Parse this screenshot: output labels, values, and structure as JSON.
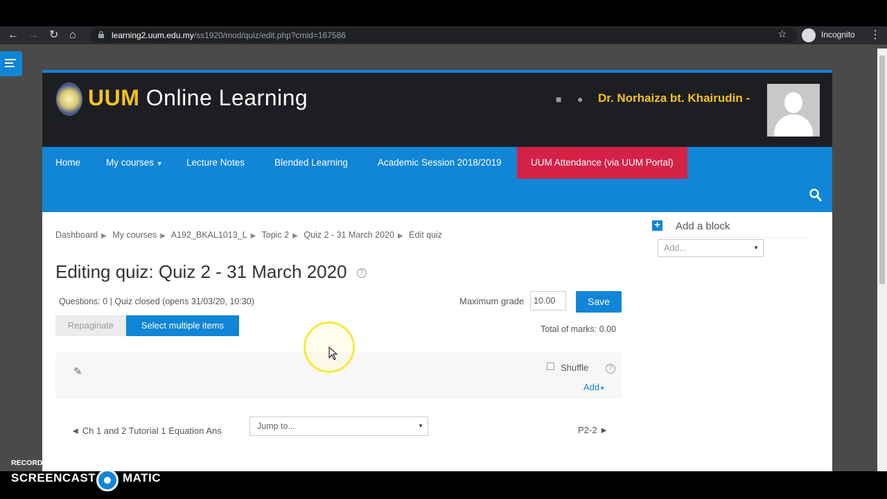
{
  "browser": {
    "url_host": "learning2.uum.edu.my",
    "url_path": "/ss1920/mod/quiz/edit.php?cmid=167586",
    "profile_label": "Incognito"
  },
  "header": {
    "brand_uum": "UUM",
    "brand_rest": " Online Learning",
    "username": "Dr. Norhaiza bt. Khairudin -"
  },
  "nav": {
    "items": [
      "Home",
      "My courses",
      "Lecture Notes",
      "Blended Learning",
      "Academic Session 2018/2019",
      "UUM Attendance (via UUM Portal)"
    ],
    "accent": "#1185d6",
    "attendance_color": "#d42247"
  },
  "breadcrumb": [
    "Dashboard",
    "My courses",
    "A192_BKAL1013_L",
    "Topic 2",
    "Quiz 2 - 31 March 2020",
    "Edit quiz"
  ],
  "quiz": {
    "title": "Editing quiz: Quiz 2 - 31 March 2020",
    "info": "Questions: 0 | Quiz closed (opens 31/03/20, 10:30)",
    "max_grade_label": "Maximum grade",
    "max_grade_value": "10.00",
    "save_label": "Save",
    "repaginate_label": "Repaginate",
    "select_multiple_label": "Select multiple items",
    "total_marks": "Total of marks: 0.00",
    "shuffle_label": "Shuffle",
    "add_label": "Add",
    "prev_link": "◄ Ch 1 and 2 Tutorial 1 Equation Ans",
    "jump_placeholder": "Jump to...",
    "next_link": "P2-2 ►"
  },
  "block": {
    "title": "Add a block",
    "select_value": "Add..."
  },
  "watermark": {
    "recorded": "RECORDED WITH",
    "left": "SCREENCAST",
    "right": "MATIC"
  }
}
